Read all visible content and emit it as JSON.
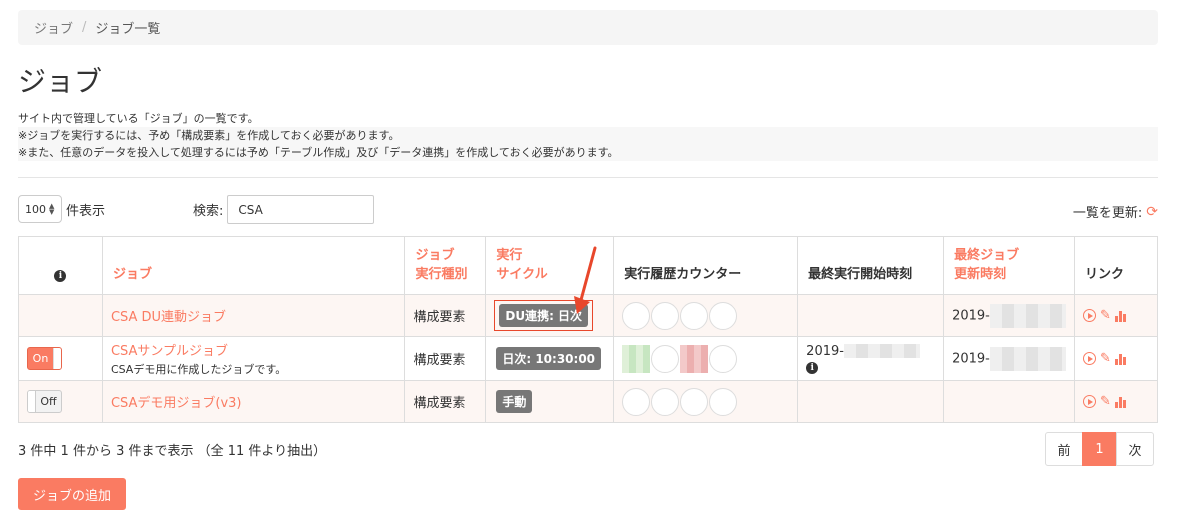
{
  "breadcrumb": {
    "root": "ジョブ",
    "separator": "/",
    "current": "ジョブ一覧"
  },
  "page_title": "ジョブ",
  "description": {
    "line1": "サイト内で管理している「ジョブ」の一覧です。",
    "line2": "※ジョブを実行するには、予め「構成要素」を作成しておく必要があります。",
    "line3": "※また、任意のデータを投入して処理するには予め「テーブル作成」及び「データ連携」を作成しておく必要があります。"
  },
  "length": {
    "value": "100",
    "label": "件表示"
  },
  "search": {
    "label": "検索:",
    "value": "CSA"
  },
  "refresh": {
    "label": "一覧を更新:",
    "icon": "refresh-icon"
  },
  "table": {
    "headers": {
      "info": "i",
      "job": "ジョブ",
      "type_line1": "ジョブ",
      "type_line2": "実行種別",
      "cycle_line1": "実行",
      "cycle_line2": "サイクル",
      "counter": "実行履歴カウンター",
      "last_start": "最終実行開始時刻",
      "updated_line1": "最終ジョブ",
      "updated_line2": "更新時刻",
      "link": "リンク"
    },
    "rows": [
      {
        "toggle": "",
        "name": "CSA DU連動ジョブ",
        "sub": "",
        "type": "構成要素",
        "cycle": "DU連携: 日次",
        "last_start": "",
        "updated": "2019-"
      },
      {
        "toggle": "On",
        "name": "CSAサンプルジョブ",
        "sub": "CSAデモ用に作成したジョブです。",
        "type": "構成要素",
        "cycle": "日次: 10:30:00",
        "last_start": "2019-",
        "updated": "2019-"
      },
      {
        "toggle": "Off",
        "name": "CSAデモ用ジョブ(v3)",
        "sub": "",
        "type": "構成要素",
        "cycle": "手動",
        "last_start": "",
        "updated": ""
      }
    ]
  },
  "footer": {
    "info": "3 件中 1 件から 3 件まで表示 （全 11 件より抽出）"
  },
  "pagination": {
    "prev": "前",
    "page": "1",
    "next": "次"
  },
  "add_button": "ジョブの追加",
  "colors": {
    "accent": "#fa7b62",
    "badge": "#777777",
    "highlight": "#e8472b"
  }
}
